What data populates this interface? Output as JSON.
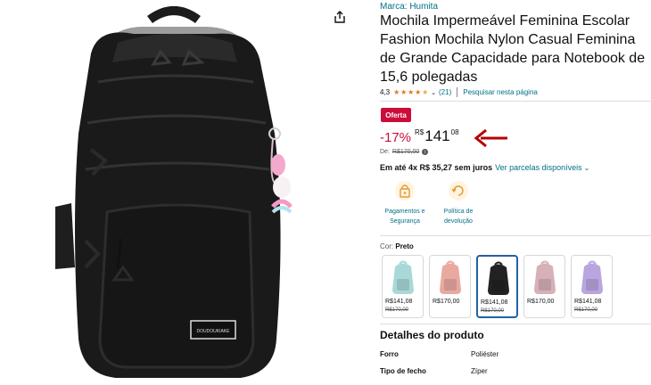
{
  "product": {
    "brand": "Marca: Humita",
    "title": "Mochila Impermeável Feminina Escolar Fashion Mochila Nylon Casual Feminina de Grande Capacidade para Notebook de 15,6 polegadas",
    "rating_value": "4,3",
    "rating_stars": 4.3,
    "rating_count": "(21)",
    "search_link": "Pesquisar nesta página"
  },
  "price": {
    "offer_badge": "Oferta",
    "discount": "-17%",
    "currency": "R$",
    "whole": "141",
    "fraction": "08",
    "list_label": "De:",
    "list_price": "R$170,00",
    "installments_prefix": "Em até 4x R$ 35,27 sem juros",
    "installments_link": "Ver parcelas disponíveis",
    "accent_red": "#cc0c39",
    "arrow_color": "#b30000"
  },
  "features": [
    {
      "icon": "lock-bag-icon",
      "label_line1": "Pagamentos e",
      "label_line2": "Segurança"
    },
    {
      "icon": "return-policy-icon",
      "label_line1": "Política de",
      "label_line2": "devolução"
    }
  ],
  "color": {
    "label": "Cor:",
    "selected": "Preto",
    "options": [
      {
        "name": "teal",
        "color": "#a9d8d8",
        "price": "R$141,08",
        "list_price": "R$170,00"
      },
      {
        "name": "pink",
        "color": "#e9a9a0",
        "price": "R$170,00",
        "list_price": ""
      },
      {
        "name": "black",
        "color": "#222222",
        "price": "R$141,08",
        "list_price": "R$170,00"
      },
      {
        "name": "rose",
        "color": "#d7b0b8",
        "price": "R$170,00",
        "list_price": ""
      },
      {
        "name": "purple",
        "color": "#b9a5e0",
        "price": "R$141,08",
        "list_price": "R$170,00"
      }
    ]
  },
  "product_details": {
    "heading": "Detalhes do produto",
    "rows": [
      {
        "key": "Forro",
        "value": "Poliéster"
      },
      {
        "key": "Tipo de fecho",
        "value": "Zíper"
      }
    ]
  },
  "image": {
    "badge_text": "DOUDOUKIAKE"
  }
}
